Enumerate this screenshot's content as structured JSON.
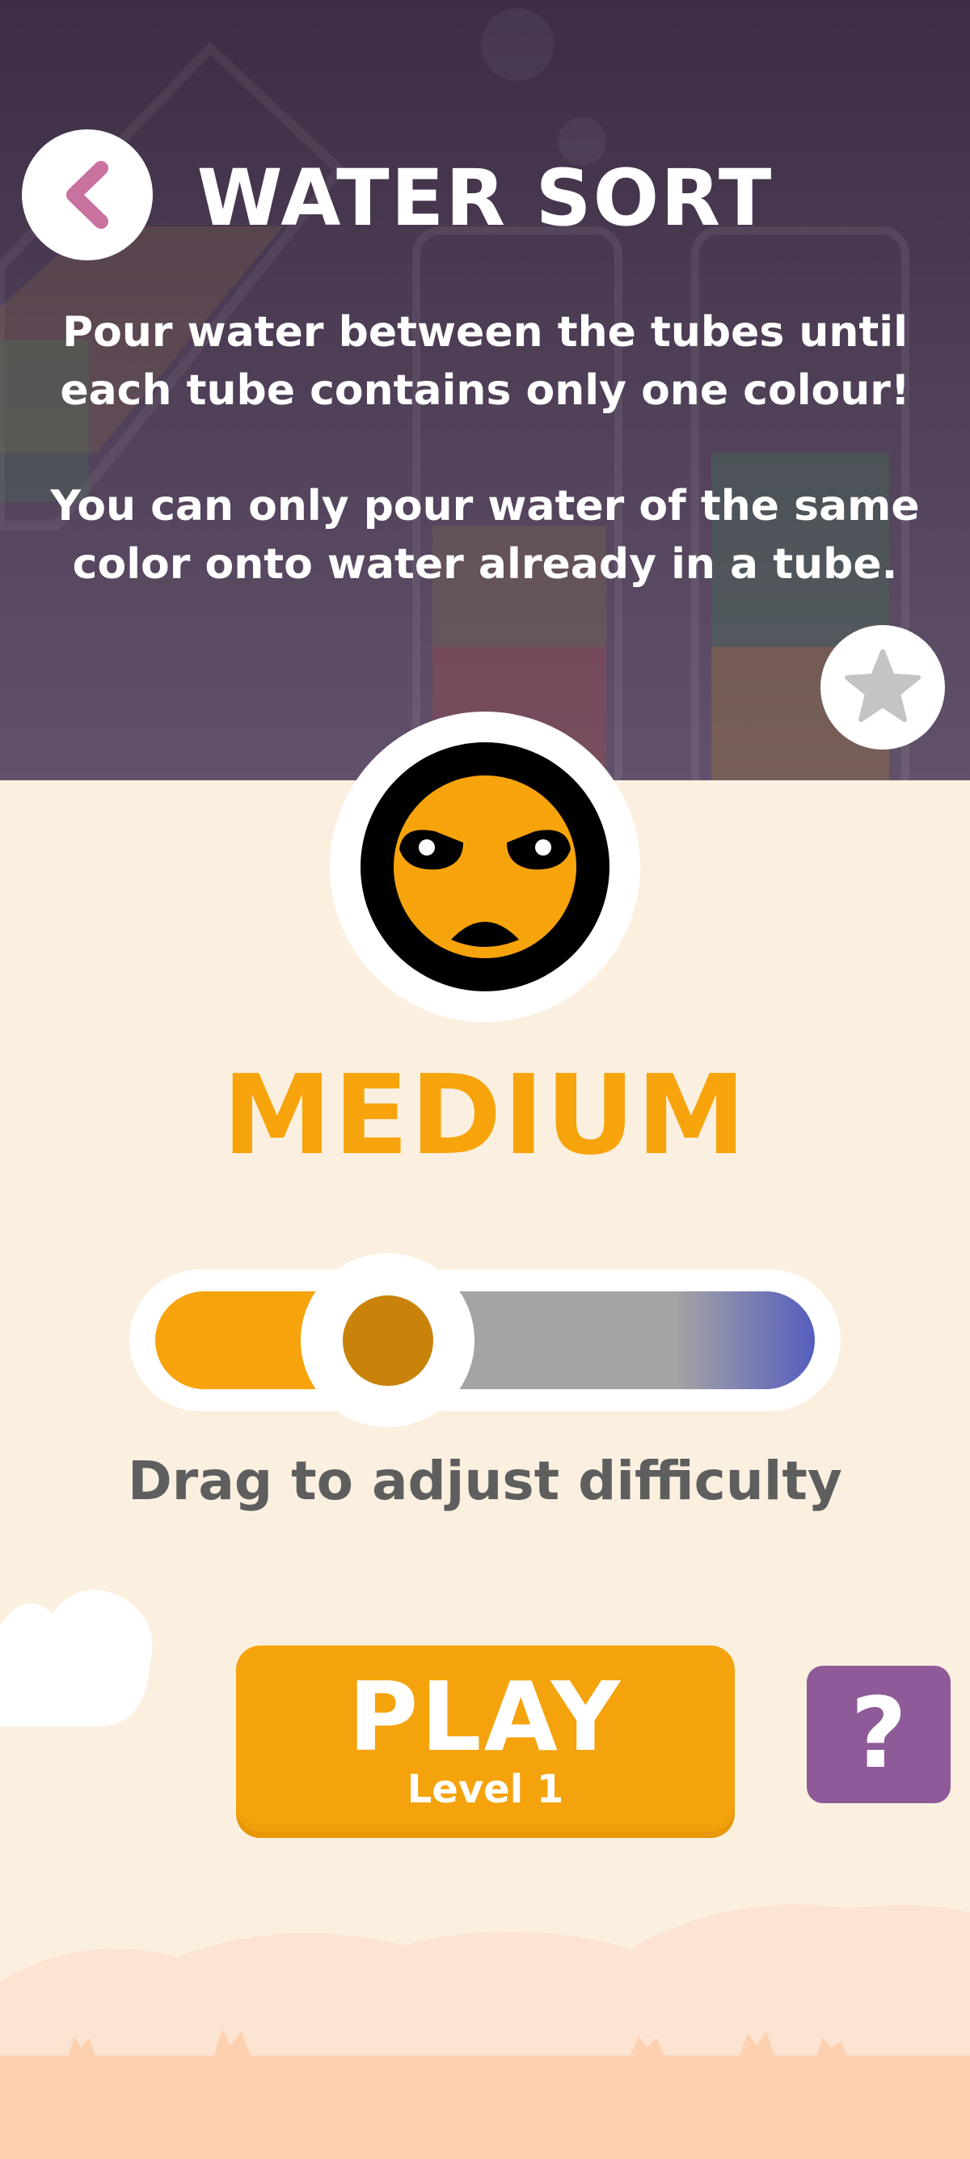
{
  "header": {
    "title": "WATER SORT",
    "instructions": [
      "Pour water between the tubes until",
      "each tube contains only one colour!",
      "You can only pour water of the same",
      "color onto water already in a tube."
    ]
  },
  "difficulty": {
    "label": "MEDIUM",
    "level_fraction": 0.26,
    "hint": "Drag to adjust difficulty"
  },
  "play": {
    "label": "PLAY",
    "level": "Level 1"
  },
  "help": {
    "label": "?"
  },
  "icons": {
    "back": "chevron-left-icon",
    "favorite": "star-icon",
    "face": "grumpy-face-icon"
  },
  "colors": {
    "accent": "#f7a40c",
    "header_bg": "#3c2d44",
    "page_bg": "#fbf0e0",
    "help_bg": "#8e5a98",
    "back_chevron": "#c9719f",
    "slider_hard": "#565dbe"
  }
}
